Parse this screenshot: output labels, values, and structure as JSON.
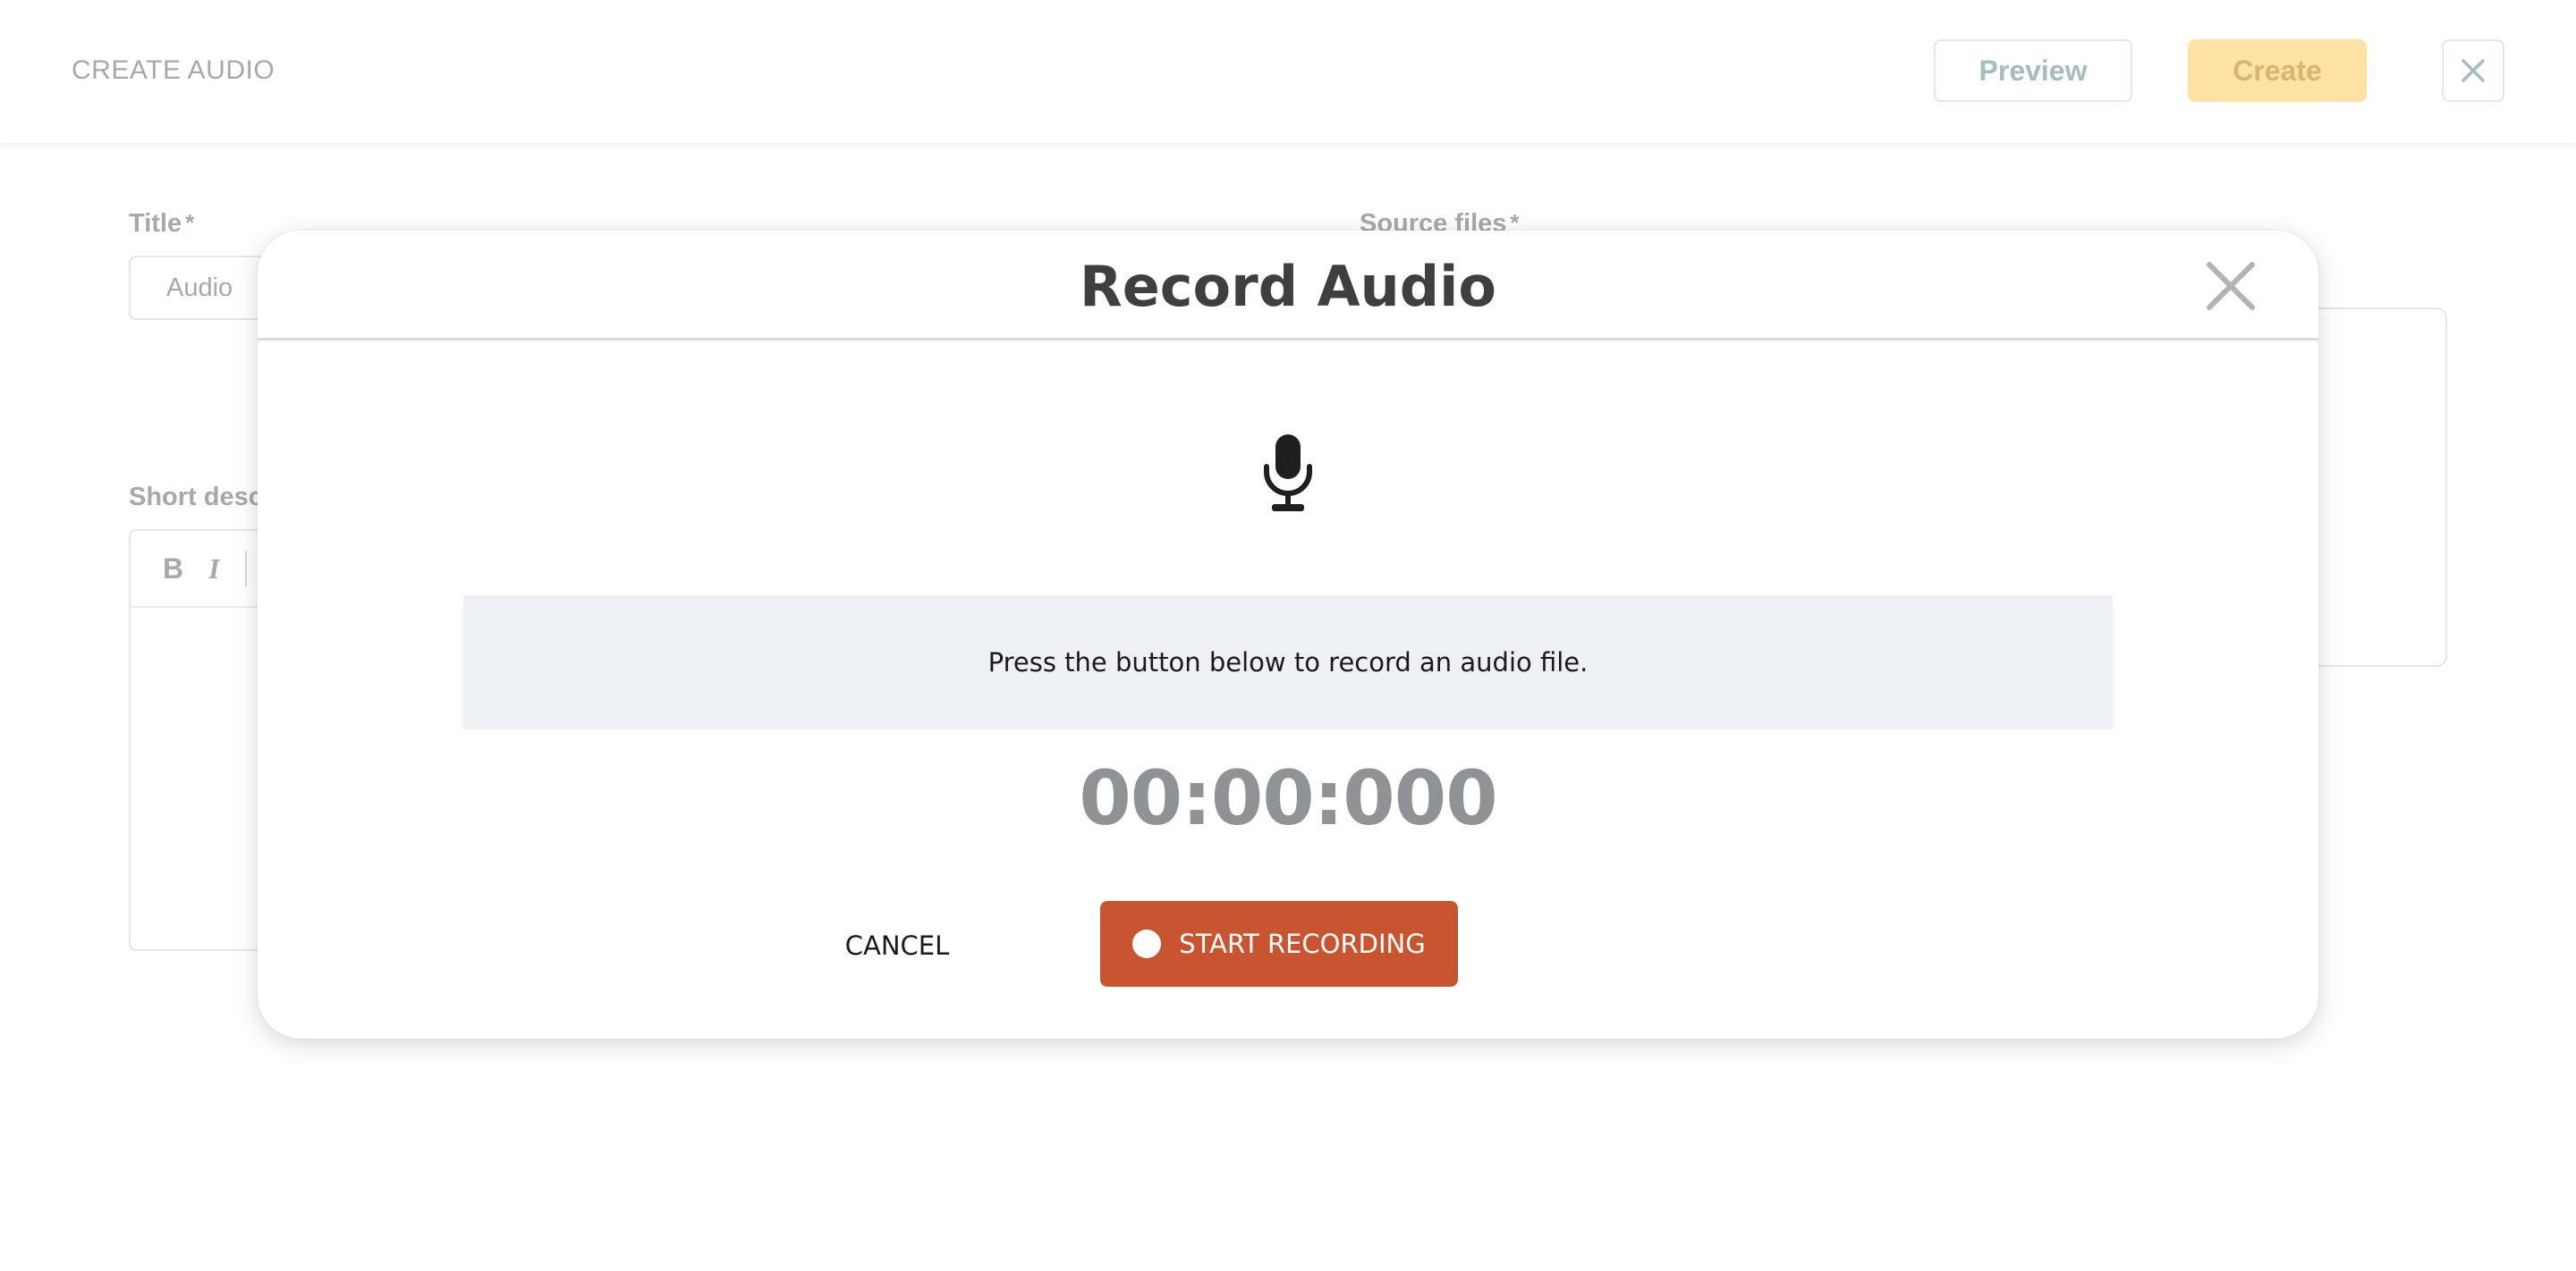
{
  "page": {
    "title": "CREATE AUDIO",
    "preview_label": "Preview",
    "create_label": "Create",
    "close_icon": "close-icon"
  },
  "form": {
    "title_label": "Title",
    "required_mark": "*",
    "title_value": "Audio",
    "source_files_label": "Source files",
    "short_description_label": "Short desc",
    "toolbar": {
      "bold_label": "B",
      "italic_label": "I"
    }
  },
  "modal": {
    "title": "Record Audio",
    "close_icon": "close-icon",
    "mic_icon": "microphone-icon",
    "info_text": "Press the button below to record an audio file.",
    "timer": "00:00:000",
    "cancel_label": "CANCEL",
    "start_label": "START RECORDING"
  },
  "colors": {
    "record_button": "#c8552f",
    "create_button": "#fde2a3",
    "info_background": "#edf1f5",
    "timer_text": "#8f9396"
  }
}
